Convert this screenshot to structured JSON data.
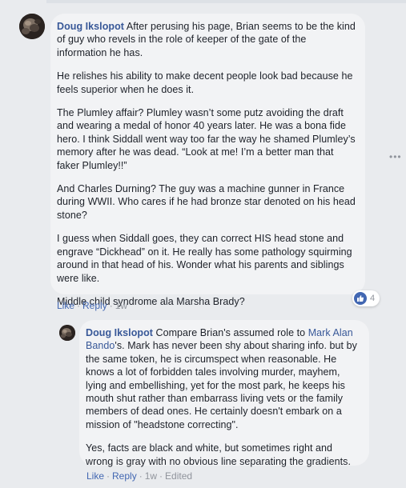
{
  "comment": {
    "author": "Doug Ikslopot",
    "paragraphs": [
      "After perusing his page, Brian seems to be the kind of guy who revels in the role of keeper of the gate of the information he has.",
      "He relishes his ability to make decent people look bad because he feels superior when he does it.",
      "The Plumley affair? Plumley wasn’t some putz avoiding the draft and wearing a medal of honor 40 years later. He was a bona fide hero. I think Siddall went way too far the way he shamed Plumley’s memory after he was dead. “Look at me! I’m a better man that faker Plumley!!”",
      "And Charles Durning? The guy was a machine gunner in France during WWII. Who cares if he had bronze star denoted on his head stone?",
      "I guess when Siddall goes, they can correct HIS head stone and engrave “Dickhead” on it. He really has some pathology squirming around in that head of his. Wonder what his parents and siblings were like.",
      "Middle child syndrome ala Marsha Brady?"
    ],
    "actions": {
      "like": "Like",
      "reply": "Reply",
      "time": "1w"
    },
    "reactions": {
      "icon": "thumbs-up-icon",
      "count": "4"
    }
  },
  "reply": {
    "author": "Doug Ikslopot",
    "intro": "Compare Brian's assumed role to",
    "mention": "Mark Alan Bando",
    "rest": "'s. Mark has never been shy about sharing info. but by the same token, he is circumspect when reasonable. He knows a lot of forbidden tales involving murder, mayhem, lying and embellishing, yet for the most park, he keeps his mouth shut rather than embarrass living vets or the family members of dead ones. He certainly doesn't embark on a mission of \"headstone correcting\".",
    "paragraph2": "Yes, facts are black and white, but sometimes right and wrong is gray with no obvious line separating the gradients.",
    "actions": {
      "like": "Like",
      "reply": "Reply",
      "time": "1w",
      "edited": "Edited"
    }
  },
  "colors": {
    "link": "#385898",
    "action_link": "#4267b2",
    "meta_gray": "#90949c",
    "bubble_bg": "#f2f3f5",
    "page_bg": "#e9ebee"
  }
}
